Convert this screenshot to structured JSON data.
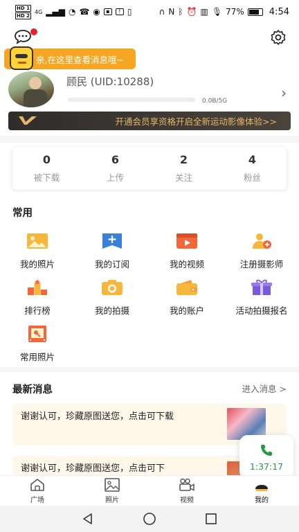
{
  "status_bar": {
    "sim1": "HD 1",
    "sim2": "HD 2",
    "network": "4G",
    "battery": "77%",
    "time": "4:54"
  },
  "header": {
    "message_icon": "chat-bubble-icon",
    "settings_icon": "gear-icon"
  },
  "tooltip": {
    "text": "亲,在这里查看消息哦~"
  },
  "profile": {
    "name": "顾民",
    "uid": "(UID:10288)",
    "storage_text": "0.0B/5G",
    "storage_used_fraction": 0
  },
  "vip_banner": {
    "text": "开通会员享资格开启全新运动影像体验>>"
  },
  "stats": [
    {
      "value": "0",
      "label": "被下载"
    },
    {
      "value": "6",
      "label": "上传"
    },
    {
      "value": "2",
      "label": "关注"
    },
    {
      "value": "4",
      "label": "粉丝"
    }
  ],
  "common": {
    "title": "常用",
    "items": [
      {
        "label": "我的照片",
        "icon": "photo-icon"
      },
      {
        "label": "我的订阅",
        "icon": "subscribe-icon"
      },
      {
        "label": "我的视频",
        "icon": "video-icon"
      },
      {
        "label": "注册摄影师",
        "icon": "add-user-icon"
      },
      {
        "label": "排行榜",
        "icon": "ranking-icon"
      },
      {
        "label": "我的拍摄",
        "icon": "camera-icon"
      },
      {
        "label": "我的账户",
        "icon": "wallet-icon"
      },
      {
        "label": "活动拍摄报名",
        "icon": "gift-icon"
      },
      {
        "label": "常用照片",
        "icon": "frequent-photo-icon"
      }
    ]
  },
  "news": {
    "title": "最新消息",
    "more": "进入消息 >",
    "items": [
      {
        "text": "谢谢认可，珍藏原图送您，点击可下载"
      },
      {
        "text": "谢谢认可，珍藏原图送您，点击可下"
      }
    ]
  },
  "call": {
    "time": "1:37:17"
  },
  "bottom_nav": [
    {
      "label": "广场",
      "icon": "home-icon"
    },
    {
      "label": "照片",
      "icon": "image-icon"
    },
    {
      "label": "视频",
      "icon": "video-camera-icon"
    },
    {
      "label": "我的",
      "icon": "profile-icon"
    }
  ]
}
